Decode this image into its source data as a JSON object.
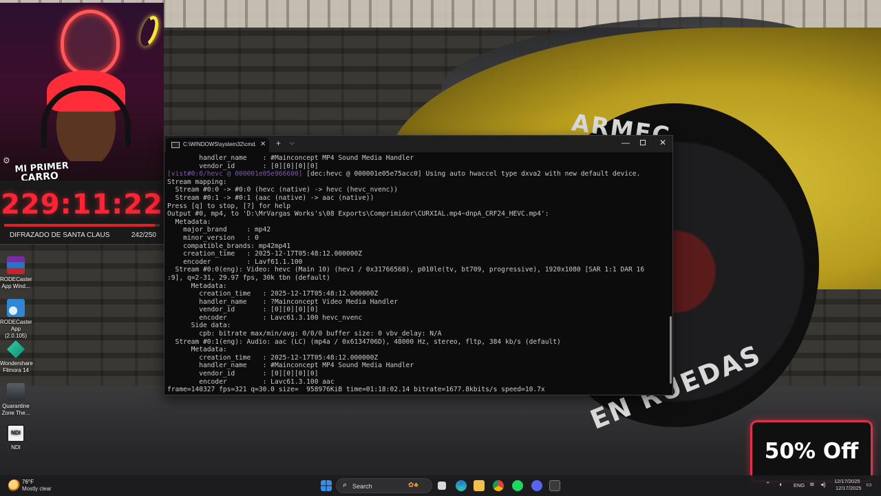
{
  "stream_overlay": {
    "badge_line1": "MI PRIMER",
    "badge_line2": "CARRO",
    "timer": "229:11:22",
    "goal_label": "DIFRAZADO DE SANTA CLAUS",
    "goal_count": "242/250",
    "goal_progress": 0.968,
    "promo": "50% Off",
    "tire_text_top": "ARMEC",
    "tire_text_bottom": "EN RUEDAS"
  },
  "desktop_icons": [
    {
      "label": "RODECaster App Wind...",
      "icon": "winrar-icon",
      "color": "#c2262e"
    },
    {
      "label": "RODECaster App (2.0.105)",
      "icon": "rodecaster-icon",
      "color": "#2f87d6"
    },
    {
      "label": "Wondershare Filmora 14",
      "icon": "filmora-icon",
      "color": "#1bb18f"
    },
    {
      "label": "Quarantine Zone The...",
      "icon": "game-icon",
      "color": "#444a52"
    },
    {
      "label": "NDI",
      "icon": "ndi-icon",
      "color": "#f2f2f2"
    }
  ],
  "terminal": {
    "tab_title": "C:\\WINDOWS\\system32\\cmd.",
    "new_tab": "+",
    "dropdown": "⌵",
    "lines": [
      "        handler_name    : #Mainconcept MP4 Sound Media Handler",
      "        vendor_id       : [0][0][0][0]",
      "[vist#0:0/hevc @ 000001e05e966600] [dec:hevc @ 000001e05e75acc0] Using auto hwaccel type dxva2 with new default device.",
      "Stream mapping:",
      "  Stream #0:0 -> #0:0 (hevc (native) -> hevc (hevc_nvenc))",
      "  Stream #0:1 -> #0:1 (aac (native) -> aac (native))",
      "Press [q] to stop, [?] for help",
      "Output #0, mp4, to 'D:\\MrVargas Works's\\08 Exports\\Comprimidor\\CURXIAL.mp4~dnpA_CRF24_HEVC.mp4':",
      "  Metadata:",
      "    major_brand     : mp42",
      "    minor_version   : 0",
      "    compatible_brands: mp42mp41",
      "    creation_time   : 2025-12-17T05:48:12.000000Z",
      "    encoder         : Lavf61.1.100",
      "  Stream #0:0(eng): Video: hevc (Main 10) (hev1 / 0x31766568), p010le(tv, bt709, progressive), 1920x1080 [SAR 1:1 DAR 16",
      ":9], q=2-31, 29.97 fps, 30k tbn (default)",
      "      Metadata:",
      "        creation_time   : 2025-12-17T05:48:12.000000Z",
      "        handler_name    : ?Mainconcept Video Media Handler",
      "        vendor_id       : [0][0][0][0]",
      "        encoder         : Lavc61.3.100 hevc_nvenc",
      "      Side data:",
      "        cpb: bitrate max/min/avg: 0/0/0 buffer size: 0 vbv_delay: N/A",
      "  Stream #0:1(eng): Audio: aac (LC) (mp4a / 0x6134706D), 48000 Hz, stereo, fltp, 384 kb/s (default)",
      "      Metadata:",
      "        creation_time   : 2025-12-17T05:48:12.000000Z",
      "        handler_name    : #Mainconcept MP4 Sound Media Handler",
      "        vendor_id       : [0][0][0][0]",
      "        encoder         : Lavc61.3.100 aac",
      "frame=140327 fps=321 q=30.0 size=  958976KiB time=01:18:02.14 bitrate=1677.8kbits/s speed=10.7x"
    ]
  },
  "taskbar": {
    "weather_temp": "76°F",
    "weather_desc": "Mostly clear",
    "search_placeholder": "Search",
    "language": "ENG",
    "time": "12/17/2025",
    "date": "12/17/2025",
    "apps": [
      {
        "name": "start-icon",
        "color": "#3a8ee6"
      },
      {
        "name": "task-view-icon",
        "color": "#d8d8d8"
      },
      {
        "name": "edge-icon",
        "color": "#2aa5c8"
      },
      {
        "name": "file-explorer-icon",
        "color": "#f2c14a"
      },
      {
        "name": "chrome-icon",
        "color": "#3fae57"
      },
      {
        "name": "spotify-icon",
        "color": "#1ed760"
      },
      {
        "name": "discord-icon",
        "color": "#5865f2"
      },
      {
        "name": "terminal-icon",
        "color": "#3a3a3a"
      }
    ]
  }
}
